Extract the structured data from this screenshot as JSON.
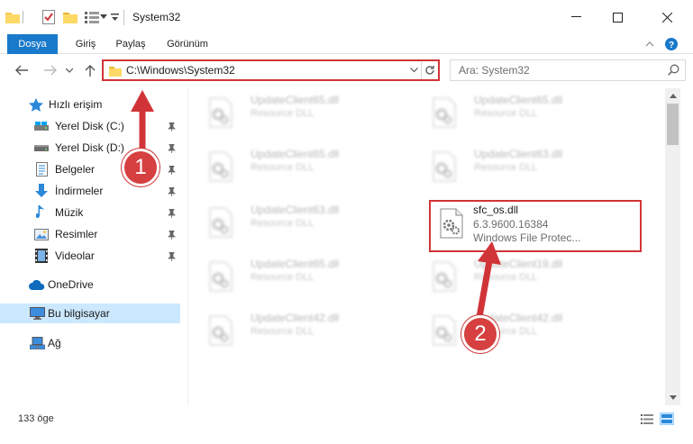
{
  "window": {
    "title": "System32",
    "minimize_glyph": "—",
    "maximize_glyph": "☐",
    "close_glyph": "✕"
  },
  "ribbon": {
    "tabs": [
      {
        "label": "Dosya",
        "active": true
      },
      {
        "label": "Giriş"
      },
      {
        "label": "Paylaş"
      },
      {
        "label": "Görünüm"
      }
    ]
  },
  "address": {
    "path": "C:\\Windows\\System32",
    "search_placeholder": "Ara: System32"
  },
  "sidebar": {
    "quick_access": "Hızlı erişim",
    "items": [
      {
        "label": "Yerel Disk (C:)",
        "icon": "drive-icon",
        "pinned": true
      },
      {
        "label": "Yerel Disk (D:)",
        "icon": "drive-icon",
        "pinned": true
      },
      {
        "label": "Belgeler",
        "icon": "documents-icon",
        "pinned": true
      },
      {
        "label": "İndirmeler",
        "icon": "download-icon",
        "pinned": true
      },
      {
        "label": "Müzik",
        "icon": "music-icon",
        "pinned": true
      },
      {
        "label": "Resimler",
        "icon": "pictures-icon",
        "pinned": true
      },
      {
        "label": "Videolar",
        "icon": "videos-icon",
        "pinned": true
      }
    ],
    "onedrive": "OneDrive",
    "this_pc": "Bu bilgisayar",
    "network": "Ağ"
  },
  "files": {
    "left_column": [
      {
        "name": "UpdateClient65.dll",
        "desc": "Resource DLL"
      },
      {
        "name": "UpdateClient65.dll",
        "desc": "Resource DLL"
      },
      {
        "name": "UpdateClient63.dll",
        "desc": "Resource DLL"
      },
      {
        "name": "UpdateClient65.dll",
        "desc": "Resource DLL"
      },
      {
        "name": "UpdateClient42.dll",
        "desc": "Resource DLL"
      }
    ],
    "right_column": [
      {
        "name": "UpdateClient65.dll",
        "desc": "Resource DLL"
      },
      {
        "name": "UpdateClient63.dll",
        "desc": "Resource DLL"
      },
      {
        "name": "sfc_os.dll",
        "desc": "6.3.9600.16384",
        "desc2": "Windows File Protec..."
      },
      {
        "name": "UpdateClient19.dll",
        "desc": "Resource DLL"
      },
      {
        "name": "UpdateClient42.dll",
        "desc": "Resource DLL"
      }
    ]
  },
  "status": {
    "item_count": "133 öge"
  },
  "annotations": {
    "step1": "1",
    "step2": "2",
    "color": "#d13438"
  }
}
